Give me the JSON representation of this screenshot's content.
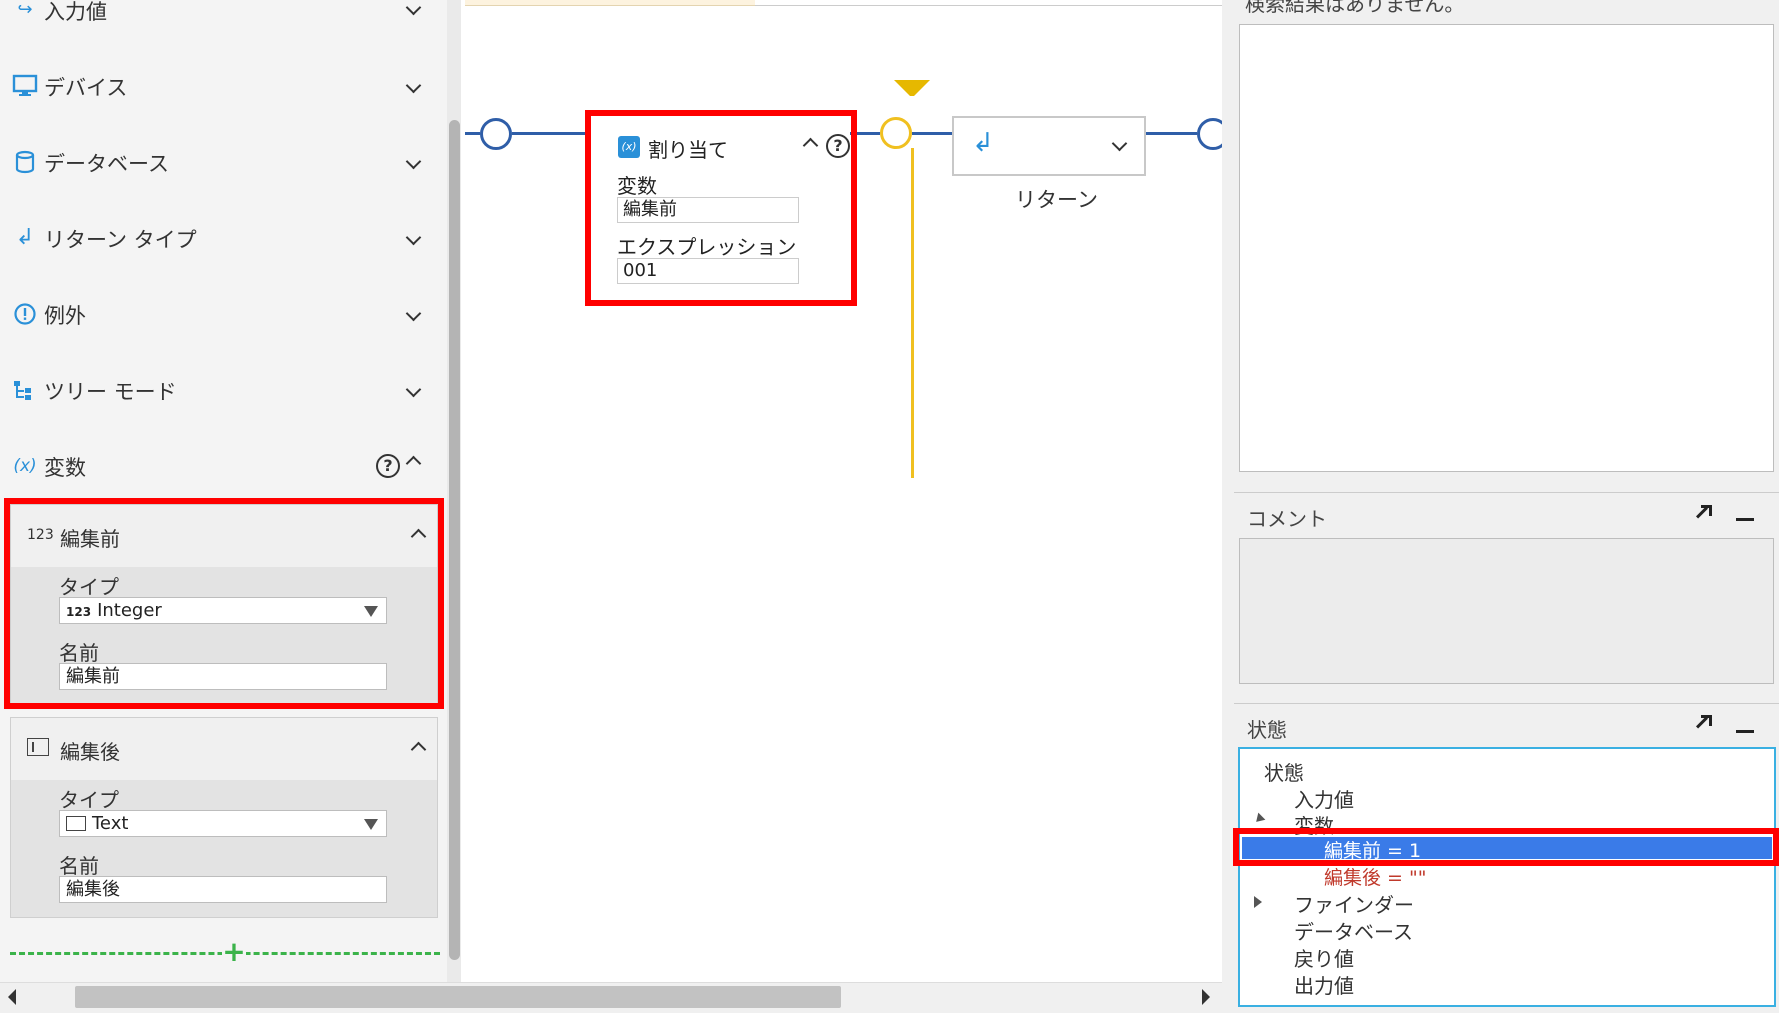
{
  "left_panel": {
    "sections": [
      {
        "label": "入力値",
        "icon": "input-icon"
      },
      {
        "label": "デバイス",
        "icon": "monitor-icon"
      },
      {
        "label": "データベース",
        "icon": "database-icon"
      },
      {
        "label": "リターン タイプ",
        "icon": "return-icon"
      },
      {
        "label": "例外",
        "icon": "exclamation-icon"
      },
      {
        "label": "ツリー モード",
        "icon": "tree-icon"
      }
    ],
    "variables": {
      "label": "変数",
      "icon": "variable-icon",
      "items": [
        {
          "name": "編集前",
          "type_icon_text": "123",
          "type_label": "タイプ",
          "type_value": "Integer",
          "name_label": "名前",
          "name_value": "編集前"
        },
        {
          "name": "編集後",
          "type_icon_text": "",
          "type_label": "タイプ",
          "type_value": "Text",
          "name_label": "名前",
          "name_value": "編集後"
        }
      ]
    }
  },
  "canvas": {
    "assign_node": {
      "title": "割り当て",
      "variable_label": "変数",
      "variable_value": "編集前",
      "expression_label": "エクスプレッション",
      "expression_value": "001"
    },
    "return_node": {
      "label": "リターン"
    }
  },
  "right_panel": {
    "search_result_text": "検索結果はありません。",
    "comment": {
      "title": "コメント"
    },
    "state": {
      "title": "状態",
      "tree": [
        {
          "text": "状態",
          "level": 0
        },
        {
          "text": "入力値",
          "level": 1
        },
        {
          "text": "変数",
          "level": 1
        },
        {
          "text": "編集前 = 1",
          "level": 2,
          "selected": true
        },
        {
          "text": "編集後 = \"\"",
          "level": 2,
          "changed": true
        },
        {
          "text": "ファインダー",
          "level": 1
        },
        {
          "text": "データベース",
          "level": 1
        },
        {
          "text": "戻り値",
          "level": 1
        },
        {
          "text": "出力値",
          "level": 1
        }
      ]
    }
  },
  "colors": {
    "accent": "#2a90d8",
    "highlight": "#ff0000",
    "selection": "#3a7be8",
    "flow_line": "#2f5ea8",
    "debug_line": "#f0c020"
  }
}
